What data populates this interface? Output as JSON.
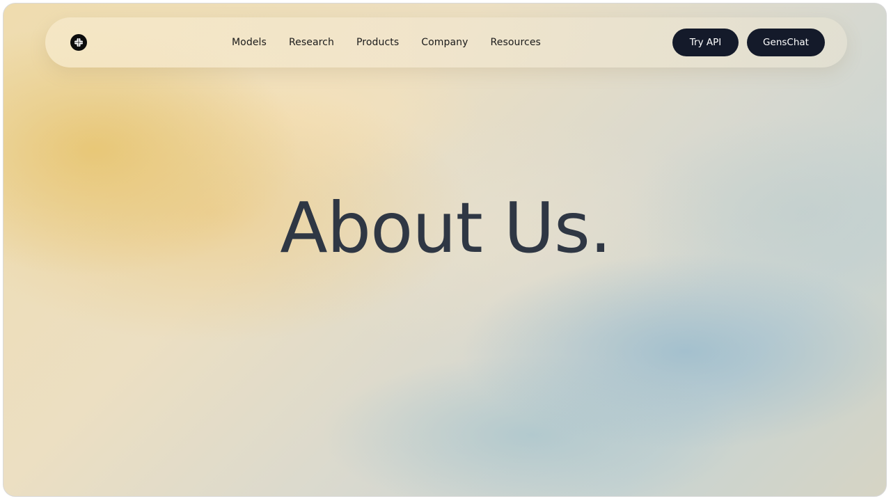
{
  "nav": {
    "logo_icon": "flower-logo-icon",
    "links": [
      "Models",
      "Research",
      "Products",
      "Company",
      "Resources"
    ],
    "buttons": {
      "try_api": "Try API",
      "genschat": "GensChat"
    }
  },
  "hero": {
    "title": "About Us."
  },
  "colors": {
    "button_bg": "#141a2a",
    "title_text": "#2f3744",
    "warm_gradient": "#e7c46e",
    "cool_gradient": "#96b9cd"
  }
}
